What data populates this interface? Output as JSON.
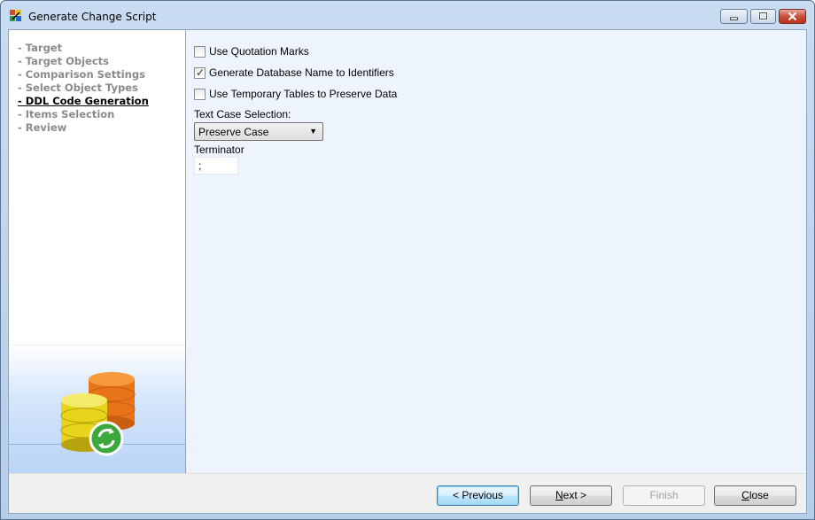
{
  "window": {
    "title": "Generate Change Script"
  },
  "steps": [
    {
      "label": "- Target",
      "active": false
    },
    {
      "label": "- Target Objects",
      "active": false
    },
    {
      "label": "- Comparison Settings",
      "active": false
    },
    {
      "label": "- Select Object Types",
      "active": false
    },
    {
      "label": "- DDL Code Generation",
      "active": true
    },
    {
      "label": "- Items Selection",
      "active": false
    },
    {
      "label": "- Review",
      "active": false
    }
  ],
  "options": {
    "use_quotation_marks": {
      "label": "Use Quotation Marks",
      "checked": false
    },
    "generate_db_name": {
      "label": "Generate Database Name to Identifiers",
      "checked": true
    },
    "use_temp_tables": {
      "label": "Use Temporary Tables to Preserve Data",
      "checked": false
    }
  },
  "text_case": {
    "label": "Text Case Selection:",
    "value": "Preserve Case"
  },
  "terminator": {
    "label": "Terminator",
    "value": ";"
  },
  "buttons": {
    "previous": "< Previous",
    "next_main": "ext >",
    "next_mnemonic": "N",
    "finish": "Finish",
    "close_main": "lose",
    "close_mnemonic": "C"
  },
  "colors": {
    "accent": "#3c7fb1",
    "disabled_text": "#a0a0a0",
    "content_bg": "#eef4fd"
  }
}
